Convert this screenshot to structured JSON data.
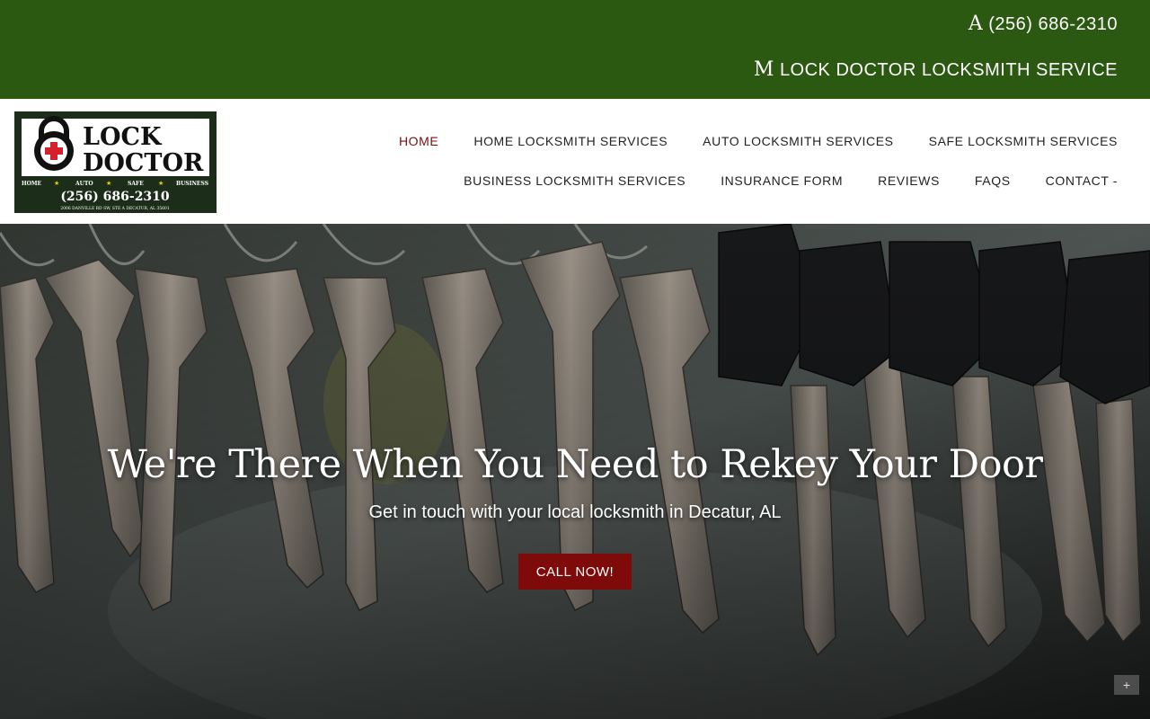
{
  "topbar": {
    "phone_icon": "A",
    "phone": "(256) 686-2310",
    "business_icon": "M",
    "business_name": "LOCK DOCTOR LOCKSMITH SERVICE",
    "bg_color": "#2c5912"
  },
  "logo": {
    "line1": "LOCK",
    "line2": "DOCTOR",
    "services": [
      "HOME",
      "AUTO",
      "SAFE",
      "BUSINESS"
    ],
    "phone": "(256) 686-2310",
    "address": "2006 DANVILLE RD SW, STE A  DECATUR, AL 35601"
  },
  "nav": {
    "row1": [
      "HOME",
      "HOME LOCKSMITH SERVICES",
      "AUTO LOCKSMITH SERVICES",
      "SAFE LOCKSMITH SERVICES"
    ],
    "row2": [
      "BUSINESS LOCKSMITH SERVICES",
      "INSURANCE FORM",
      "REVIEWS",
      "FAQS",
      "CONTACT -"
    ],
    "active": "HOME",
    "active_color": "#7a0e0e"
  },
  "hero": {
    "title": "We're There When You Need to Rekey Your Door",
    "subtitle": "Get in touch with your local locksmith in Decatur, AL",
    "cta": "CALL NOW!",
    "cta_color": "#7e0a0a",
    "corner_icon": "+"
  }
}
